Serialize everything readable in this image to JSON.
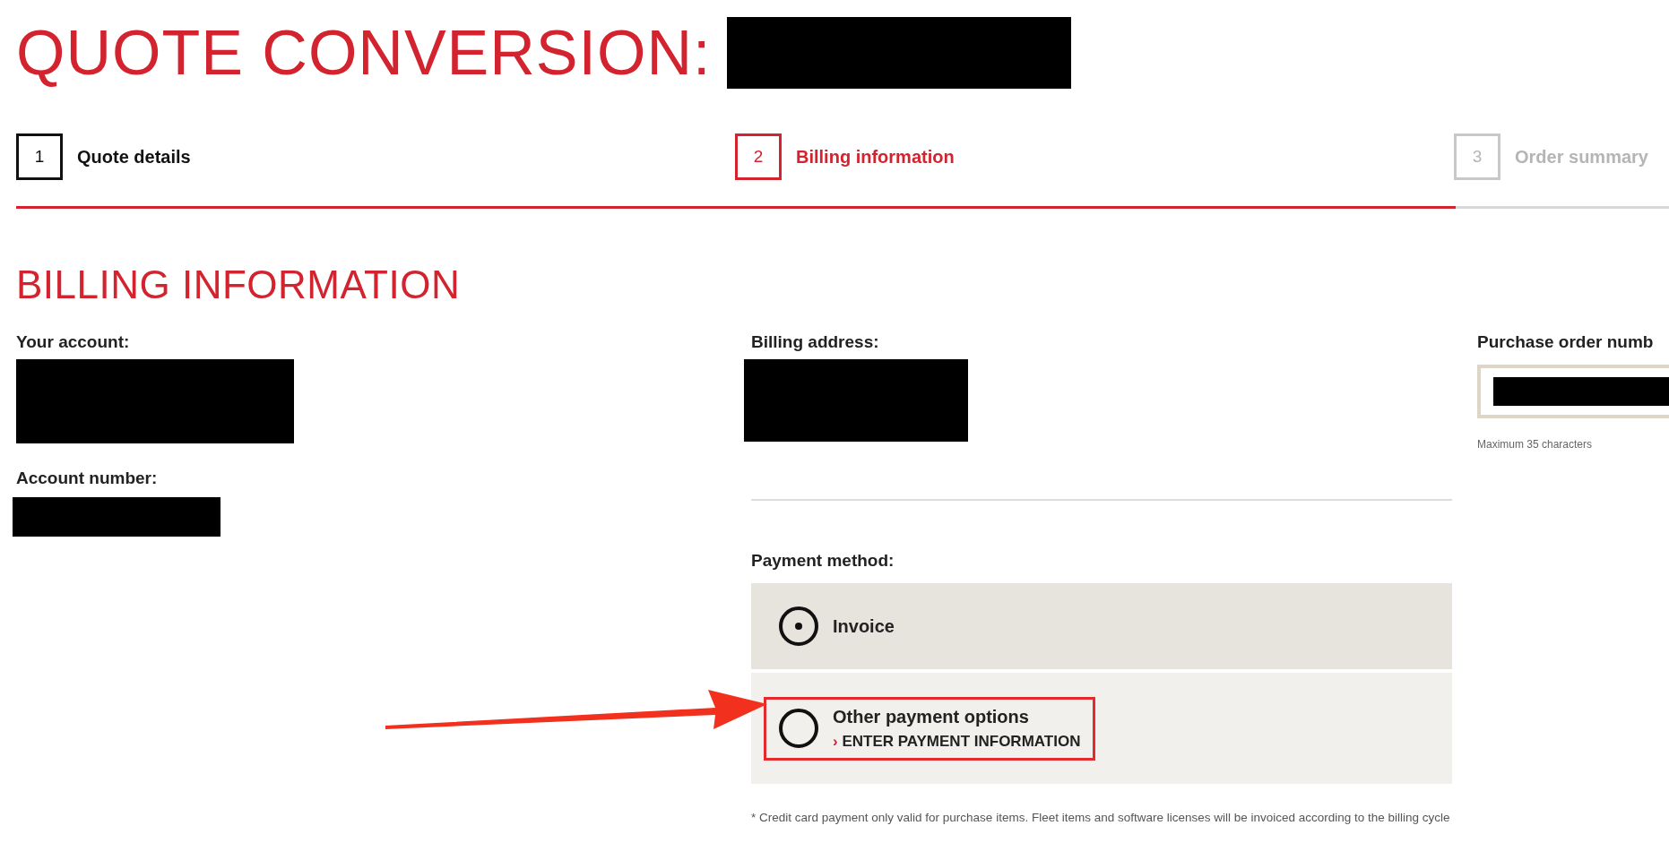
{
  "title": "QUOTE CONVERSION:",
  "steps": [
    {
      "number": "1",
      "label": "Quote details",
      "kind": "done"
    },
    {
      "number": "2",
      "label": "Billing information",
      "kind": "current"
    },
    {
      "number": "3",
      "label": "Order summary",
      "kind": "todo"
    }
  ],
  "progress": {
    "level": 0.871
  },
  "section_title": "BILLING INFORMATION",
  "account": {
    "label": "Your account:",
    "number_label": "Account number:"
  },
  "billing_address": {
    "label": "Billing address:"
  },
  "payment": {
    "label": "Payment method:",
    "options": [
      {
        "label": "Invoice",
        "selected": true,
        "highlighted": false
      },
      {
        "label": "Other payment options",
        "link": "ENTER PAYMENT INFORMATION",
        "link_marker": "›",
        "selected": false,
        "highlighted": true
      }
    ],
    "footnote": "* Credit card payment only valid for purchase items. Fleet items and software licenses will be invoiced according to the billing cycle"
  },
  "purchase_order": {
    "label": "Purchase order numb",
    "hint": "Maximum 35 characters"
  }
}
